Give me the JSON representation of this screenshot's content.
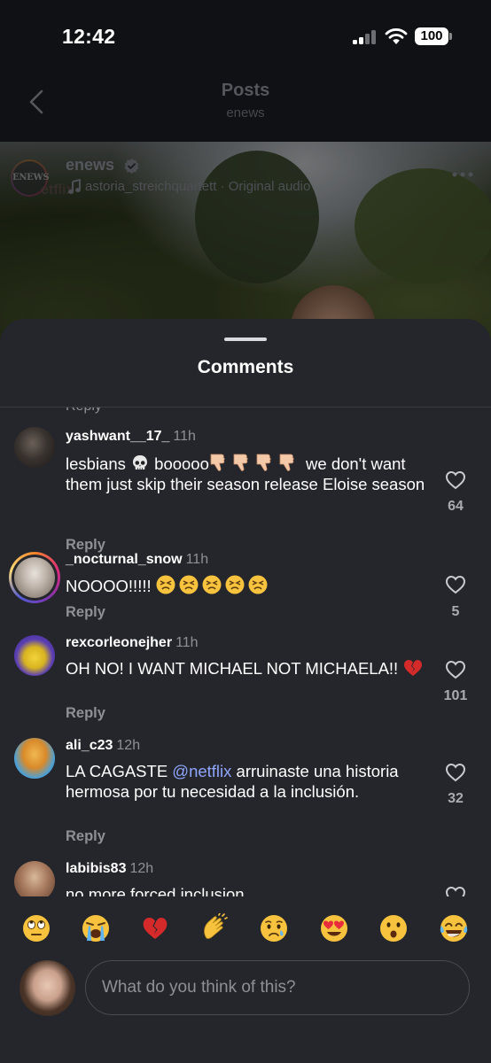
{
  "status_bar": {
    "time": "12:42",
    "battery": "100"
  },
  "nav": {
    "title": "Posts",
    "subtitle": "enews"
  },
  "post": {
    "username": "enews",
    "avatar_text": "ENEWS",
    "watermark": "etflix",
    "audio": "astoria_streichquartett · Original audio"
  },
  "sheet": {
    "title": "Comments",
    "partial_reply": "Reply"
  },
  "comments": [
    {
      "username": "yashwant__17_",
      "time": "11h",
      "text_1": "lesbians ",
      "text_2": " booooo",
      "text_3": " we don't want them just skip their season release Eloise season",
      "reply": "Reply",
      "likes": "64"
    },
    {
      "username": "_nocturnal_snow",
      "time": "11h",
      "text_1": "NOOOO!!!!! ",
      "reply": "Reply",
      "likes": "5"
    },
    {
      "username": "rexcorleonejher",
      "time": "11h",
      "text_1": "OH NO! I WANT MICHAEL NOT MICHAELA!! ",
      "reply": "Reply",
      "likes": "101"
    },
    {
      "username": "ali_c23",
      "time": "12h",
      "text_1": "LA CAGASTE ",
      "mention": "@netflix",
      "text_2": " arruinaste una historia hermosa por tu necesidad a la inclusión.",
      "reply": "Reply",
      "likes": "32"
    },
    {
      "username": "labibis83",
      "time": "12h",
      "text_1": "no more forced inclusion"
    }
  ],
  "emoji_bar": [
    "eye-roll-emoji",
    "loudly-crying-emoji",
    "broken-heart-emoji",
    "clapping-hands-emoji",
    "crying-emoji",
    "heart-eyes-emoji",
    "surprised-emoji",
    "tears-of-joy-emoji"
  ],
  "composer": {
    "placeholder": "What do you think of this?"
  },
  "colors": {
    "sheet_bg": "#25262b",
    "mention": "#8fa5ff",
    "secondary_text": "#8e9096"
  }
}
